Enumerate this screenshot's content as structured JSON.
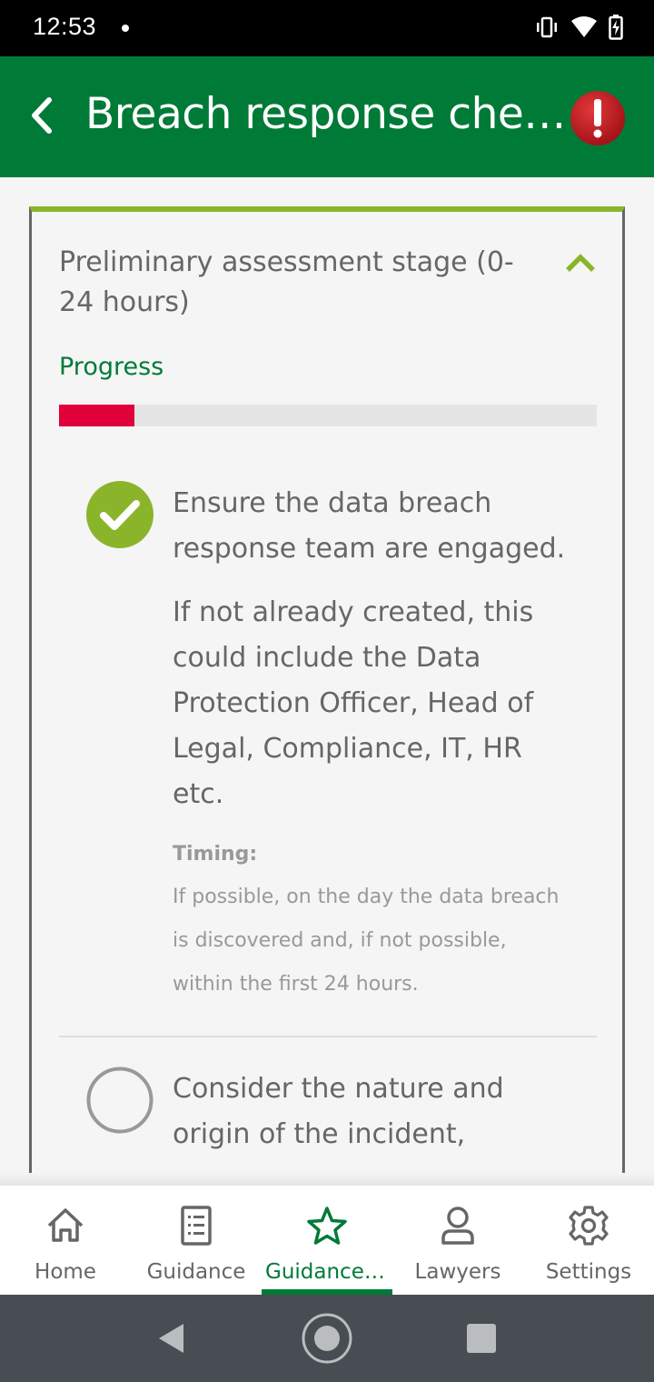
{
  "status_bar": {
    "time": "12:53",
    "icons": [
      "notification-dot",
      "vibrate-icon",
      "wifi-icon",
      "battery-charging-icon"
    ]
  },
  "app_bar": {
    "title": "Breach response checklist",
    "back_icon": "chevron-left-icon",
    "alert_icon": "exclamation-alert-icon"
  },
  "section": {
    "title": "Preliminary assessment stage (0-24 hours)",
    "expanded": true,
    "progress_label": "Progress",
    "progress_fraction": 0.14,
    "progress_color": "#e0003a",
    "accent_color": "#8ab52a",
    "items": [
      {
        "completed": true,
        "title": "Ensure the data breach response team are engaged.",
        "description": "If not already created, this could include the Data Protection Officer, Head of Legal, Compliance, IT, HR etc.",
        "timing_label": "Timing:",
        "timing_text": "If possible, on the day the data breach is discovered and, if not possible, within the first 24 hours."
      },
      {
        "completed": false,
        "title": "Consider the nature and origin of the incident,"
      }
    ]
  },
  "bottom_nav": {
    "active_index": 2,
    "items": [
      {
        "label": "Home",
        "icon": "home-icon"
      },
      {
        "label": "Guidance",
        "icon": "list-icon"
      },
      {
        "label": "Guidance checklists",
        "icon": "star-icon"
      },
      {
        "label": "Lawyers",
        "icon": "person-icon"
      },
      {
        "label": "Settings",
        "icon": "gear-icon"
      }
    ]
  },
  "colors": {
    "brand_green": "#007a37",
    "check_green": "#8ab52a",
    "progress_red": "#e0003a",
    "text_gray": "#666666"
  }
}
